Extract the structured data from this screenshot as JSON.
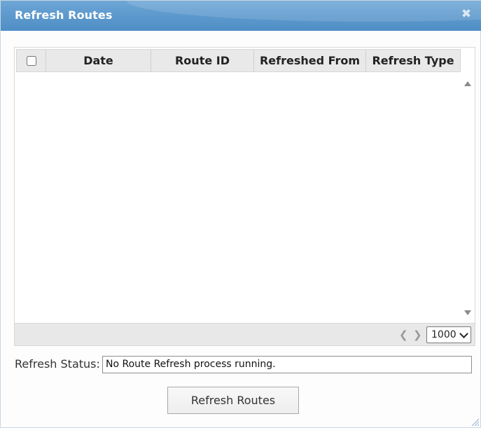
{
  "dialog": {
    "title": "Refresh Routes",
    "close_icon": "close-icon"
  },
  "grid": {
    "columns": [
      "Date",
      "Route ID",
      "Refreshed From",
      "Refresh Type"
    ],
    "rows": [],
    "pager": {
      "prev_icon": "chevron-left-icon",
      "next_icon": "chevron-right-icon",
      "page_size": "1000"
    }
  },
  "status": {
    "label": "Refresh Status:",
    "value": "No Route Refresh process running."
  },
  "actions": {
    "refresh_label": "Refresh Routes"
  },
  "colors": {
    "titlebar": "#5b98cc",
    "header_bg": "#e9e9e9",
    "footer_bg": "#e8e8e8"
  }
}
